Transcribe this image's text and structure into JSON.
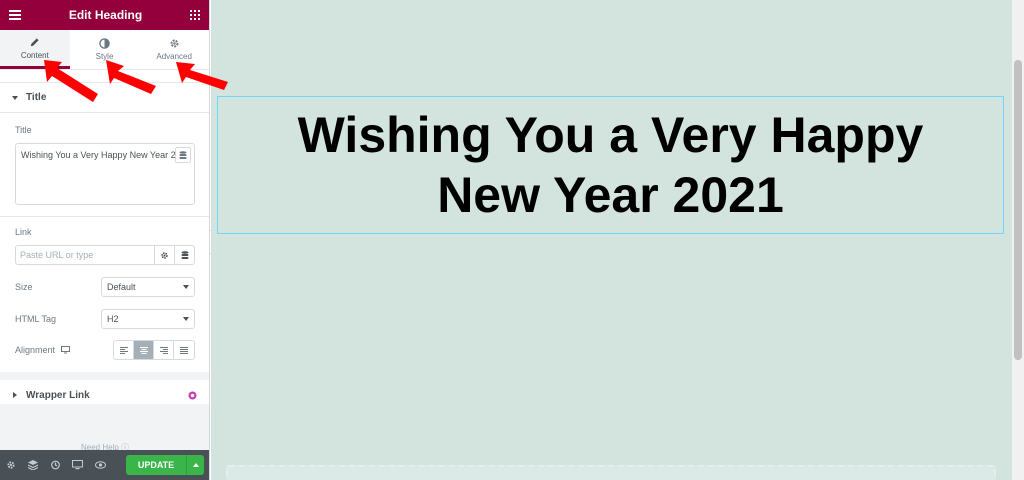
{
  "header": {
    "title": "Edit Heading"
  },
  "tabs": [
    {
      "label": "Content"
    },
    {
      "label": "Style"
    },
    {
      "label": "Advanced"
    }
  ],
  "title_section": {
    "heading": "Title",
    "field_label": "Title",
    "field_value": "Wishing You a Very Happy New Year 2021"
  },
  "link": {
    "label": "Link",
    "placeholder": "Paste URL or type"
  },
  "size": {
    "label": "Size",
    "value": "Default"
  },
  "html_tag": {
    "label": "HTML Tag",
    "value": "H2"
  },
  "alignment": {
    "label": "Alignment",
    "selected": "center"
  },
  "wrapper_link": {
    "heading": "Wrapper Link"
  },
  "footer": {
    "need_help": "Need Help",
    "update_label": "UPDATE"
  },
  "canvas": {
    "heading_text": "Wishing You a Very Happy New Year 2021"
  },
  "colors": {
    "brand": "#93003c",
    "canvas_bg": "#d3e4df",
    "update": "#39b54a",
    "annotation_arrows": "#ff0000"
  }
}
